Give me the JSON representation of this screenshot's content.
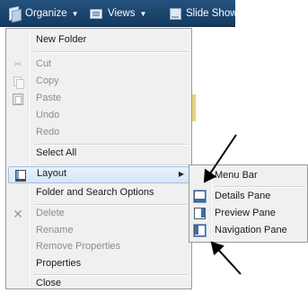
{
  "toolbar": {
    "organize_label": "Organize",
    "views_label": "Views",
    "slideshow_label": "Slide Show",
    "caret": "▼",
    "bg_color": "#1b4570"
  },
  "menu": {
    "items": [
      {
        "label": "New Folder",
        "enabled": true
      },
      {
        "label": "Cut",
        "enabled": false,
        "icon": "scissors-icon"
      },
      {
        "label": "Copy",
        "enabled": false,
        "icon": "copy-icon"
      },
      {
        "label": "Paste",
        "enabled": false,
        "icon": "paste-icon"
      },
      {
        "label": "Undo",
        "enabled": false
      },
      {
        "label": "Redo",
        "enabled": false
      },
      {
        "label": "Select All",
        "enabled": true
      },
      {
        "label": "Layout",
        "enabled": true,
        "icon": "layout-icon",
        "highlighted": true,
        "submenu_arrow": "▶"
      },
      {
        "label": "Folder and Search Options",
        "enabled": true
      },
      {
        "label": "Delete",
        "enabled": false,
        "icon": "delete-icon"
      },
      {
        "label": "Rename",
        "enabled": false
      },
      {
        "label": "Remove Properties",
        "enabled": false
      },
      {
        "label": "Properties",
        "enabled": true
      },
      {
        "label": "Close",
        "enabled": true
      }
    ]
  },
  "submenu": {
    "items": [
      {
        "label": "Menu Bar",
        "checked": false
      },
      {
        "label": "Details Pane",
        "checked": true,
        "icon": "details-pane-icon"
      },
      {
        "label": "Preview Pane",
        "checked": false,
        "icon": "preview-pane-icon"
      },
      {
        "label": "Navigation Pane",
        "checked": true,
        "icon": "navigation-pane-icon"
      }
    ]
  },
  "colors": {
    "menu_bg": "#f0f0f0",
    "highlight": "#d6e6f7",
    "disabled_text": "#8d8d8d"
  }
}
